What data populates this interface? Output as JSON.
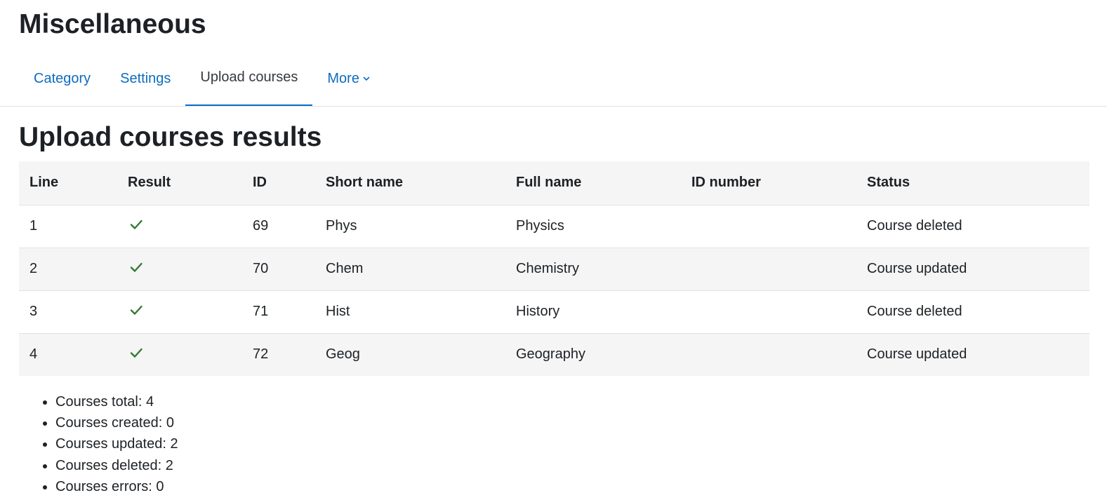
{
  "page": {
    "title": "Miscellaneous"
  },
  "tabs": [
    {
      "label": "Category",
      "active": false
    },
    {
      "label": "Settings",
      "active": false
    },
    {
      "label": "Upload courses",
      "active": true
    },
    {
      "label": "More",
      "active": false,
      "icon": "chevron-down-icon"
    }
  ],
  "section": {
    "title": "Upload courses results"
  },
  "table": {
    "headers": [
      "Line",
      "Result",
      "ID",
      "Short name",
      "Full name",
      "ID number",
      "Status"
    ],
    "rows": [
      {
        "line": "1",
        "result_icon": "check-icon",
        "id": "69",
        "short_name": "Phys",
        "full_name": "Physics",
        "id_number": "",
        "status": "Course deleted"
      },
      {
        "line": "2",
        "result_icon": "check-icon",
        "id": "70",
        "short_name": "Chem",
        "full_name": "Chemistry",
        "id_number": "",
        "status": "Course updated"
      },
      {
        "line": "3",
        "result_icon": "check-icon",
        "id": "71",
        "short_name": "Hist",
        "full_name": "History",
        "id_number": "",
        "status": "Course deleted"
      },
      {
        "line": "4",
        "result_icon": "check-icon",
        "id": "72",
        "short_name": "Geog",
        "full_name": "Geography",
        "id_number": "",
        "status": "Course updated"
      }
    ]
  },
  "summary": [
    "Courses total: 4",
    "Courses created: 0",
    "Courses updated: 2",
    "Courses deleted: 2",
    "Courses errors: 0"
  ],
  "colors": {
    "link": "#0f6cbf",
    "active_tab_underline": "#0f6cbf",
    "success_check": "#357a32",
    "row_stripe": "#f5f5f5",
    "text": "#1d2125"
  }
}
